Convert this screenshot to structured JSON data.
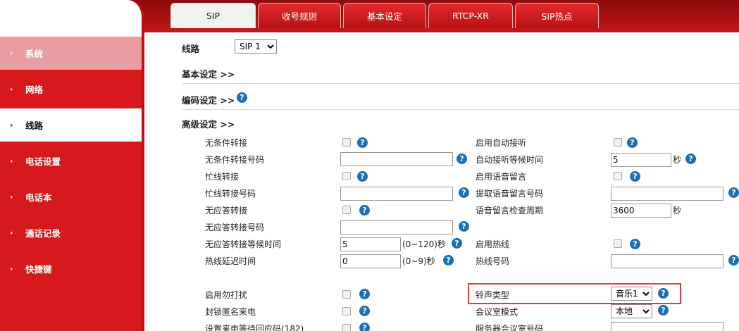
{
  "sidebar": {
    "items": [
      {
        "label": "系统"
      },
      {
        "label": "网络"
      },
      {
        "label": "线路"
      },
      {
        "label": "电话设置"
      },
      {
        "label": "电话本"
      },
      {
        "label": "通话记录"
      },
      {
        "label": "快捷键"
      }
    ]
  },
  "tabs": [
    {
      "label": "SIP"
    },
    {
      "label": "收号规则"
    },
    {
      "label": "基本设定"
    },
    {
      "label": "RTCP-XR"
    },
    {
      "label": "SIP热点"
    }
  ],
  "line": {
    "label": "线路",
    "selected": "SIP 1"
  },
  "sections": {
    "basic": "基本设定 >>",
    "codec": "编码设定 >>",
    "advanced": "高级设定 >>"
  },
  "help_glyph": "?",
  "left": {
    "cfu": "无条件转接",
    "cfu_number": "无条件转接号码",
    "cfb": "忙线转接",
    "cfb_number": "忙线转接号码",
    "cfna": "无应答转接",
    "cfna_number": "无应答转接号码",
    "cfna_wait": "无应答转接等候时间",
    "cfna_wait_value": "5",
    "cfna_wait_range": "(0~120)秒",
    "hotline_delay": "热线延迟时间",
    "hotline_delay_value": "0",
    "hotline_delay_range": "(0~9)秒",
    "dnd": "启用勿打扰",
    "anon_block": "封锁匿名来电",
    "incoming_code": "设置来电等待回应码(182)"
  },
  "right": {
    "auto_answer": "启用自动接听",
    "auto_answer_wait": "自动接听等候时间",
    "auto_answer_wait_value": "5",
    "seconds_unit": "秒",
    "voicemail": "启用语音留言",
    "voicemail_number": "提取语音留言号码",
    "voicemail_period": "语音留言检查周期",
    "voicemail_period_value": "3600",
    "hotline": "启用热线",
    "hotline_number": "热线号码",
    "ring_type": "铃声类型",
    "ring_value": "音乐1",
    "conference": "会议室模式",
    "conference_value": "本地",
    "server_conf": "服务器会议室号码"
  }
}
